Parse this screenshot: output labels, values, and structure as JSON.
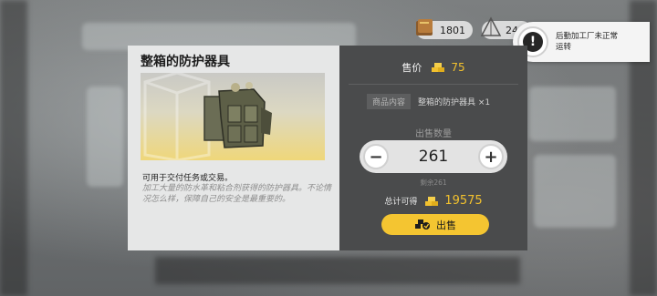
{
  "resources": {
    "books": "1801",
    "tents": "24"
  },
  "notification": {
    "icon": "exclamation-icon",
    "text": "后勤加工厂未正常运转"
  },
  "dialog": {
    "title": "整箱的防护器具",
    "item_image": "protective-gear-crate",
    "description_main": "可用于交付任务或交易。",
    "description_flavor": "加工大量的防水革和粘合剂获得的防护器具。不论情况怎么样，保障自己的安全是最重要的。",
    "price_label": "售价",
    "price_value": "75",
    "content_tag": "商品内容",
    "content_value": "整箱的防护器具 ×1",
    "quantity_label": "出售数量",
    "quantity_value": "261",
    "minus_label": "−",
    "plus_label": "+",
    "remaining": "剩余261",
    "total_label": "总计可得",
    "total_value": "19575",
    "sell_label": "出售"
  },
  "colors": {
    "accent_gold": "#f2c12e",
    "button_gold": "#f4c531",
    "panel_dark": "#4a4b4c",
    "panel_light": "#e6e7e7"
  }
}
